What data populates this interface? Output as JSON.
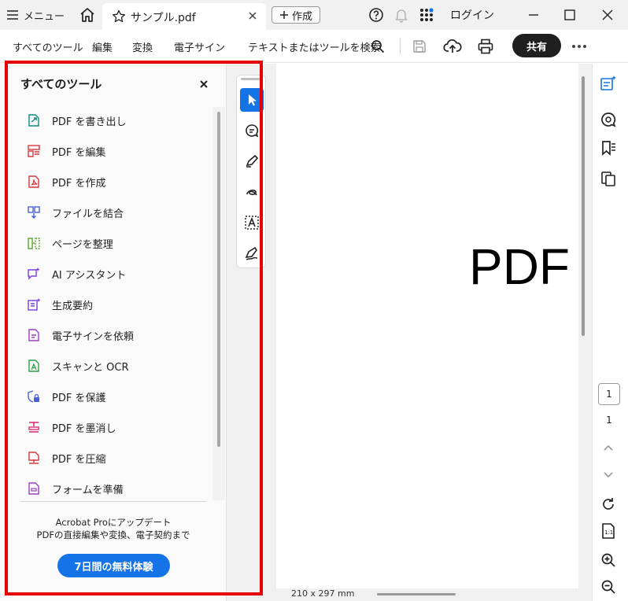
{
  "titlebar": {
    "menu_label": "メニュー",
    "tab_title": "サンプル.pdf",
    "new_tab_label": "作成",
    "login_label": "ログイン"
  },
  "toolbar": {
    "menus": [
      "すべてのツール",
      "編集",
      "変換",
      "電子サイン"
    ],
    "search_label": "テキストまたはツールを検索",
    "share_label": "共有"
  },
  "panel": {
    "title": "すべてのツール",
    "tools": [
      {
        "label": "PDF を書き出し",
        "icon": "export-pdf-icon",
        "color": "#0e8a7a"
      },
      {
        "label": "PDF を編集",
        "icon": "edit-pdf-icon",
        "color": "#d7373f"
      },
      {
        "label": "PDF を作成",
        "icon": "create-pdf-icon",
        "color": "#d7373f"
      },
      {
        "label": "ファイルを結合",
        "icon": "combine-files-icon",
        "color": "#4b5fd6"
      },
      {
        "label": "ページを整理",
        "icon": "organize-pages-icon",
        "color": "#5aa52b"
      },
      {
        "label": "AI アシスタント",
        "icon": "ai-assistant-icon",
        "color": "#7a3ee0"
      },
      {
        "label": "生成要約",
        "icon": "generative-summary-icon",
        "color": "#7a3ee0"
      },
      {
        "label": "電子サインを依頼",
        "icon": "request-esign-icon",
        "color": "#9b3fc4"
      },
      {
        "label": "スキャンと OCR",
        "icon": "scan-ocr-icon",
        "color": "#2f9e44"
      },
      {
        "label": "PDF を保護",
        "icon": "protect-pdf-icon",
        "color": "#4b5fd6"
      },
      {
        "label": "PDF を墨消し",
        "icon": "redact-pdf-icon",
        "color": "#d6246e"
      },
      {
        "label": "PDF を圧縮",
        "icon": "compress-pdf-icon",
        "color": "#d7373f"
      },
      {
        "label": "フォームを準備",
        "icon": "prepare-form-icon",
        "color": "#9b3fc4"
      }
    ],
    "promo_line1": "Acrobat Proにアップデート",
    "promo_line2": "PDFの直接編集や変換、電子契約まで",
    "trial_label": "7日間の無料体験"
  },
  "document": {
    "page_text": "PDF",
    "page_size": "210 x 297 mm"
  },
  "page_nav": {
    "current_page": "1",
    "total_pages": "1"
  },
  "colors": {
    "accent_blue": "#1473e6",
    "highlight_red": "#e60000",
    "share_button": "#1f1f1f"
  }
}
